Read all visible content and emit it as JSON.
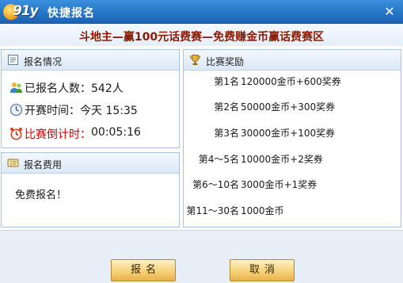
{
  "window": {
    "logo_text": "91y",
    "title": "快捷报名",
    "close_glyph": "✕"
  },
  "subtitle": "斗地主—赢100元话费赛—免费赚金币赢话费赛区",
  "info_panel": {
    "title": "报名情况",
    "signed_up_label": "已报名人数：",
    "signed_up_value": "542人",
    "start_label": "开赛时间：",
    "start_value": "今天 15:35",
    "countdown_label": "比赛倒计时：",
    "countdown_value": "00:05:16"
  },
  "fee_panel": {
    "title": "报名费用",
    "text": "免费报名！"
  },
  "prize_panel": {
    "title": "比赛奖励",
    "rows": [
      {
        "rank": "第1名",
        "reward": "120000金币+600奖券"
      },
      {
        "rank": "第2名",
        "reward": "50000金币+300奖券"
      },
      {
        "rank": "第3名",
        "reward": "30000金币+100奖券"
      },
      {
        "rank": "第4～5名",
        "reward": "10000金币+2奖券"
      },
      {
        "rank": "第6～10名",
        "reward": "3000金币+1奖券"
      },
      {
        "rank": "第11～30名",
        "reward": "1000金币"
      }
    ]
  },
  "buttons": {
    "signup": "报名",
    "cancel": "取消"
  },
  "colors": {
    "titlebar": "#2676c8",
    "subtitle_text": "#8a1a00",
    "countdown_text": "#d40000",
    "button": "#f6d27a"
  }
}
